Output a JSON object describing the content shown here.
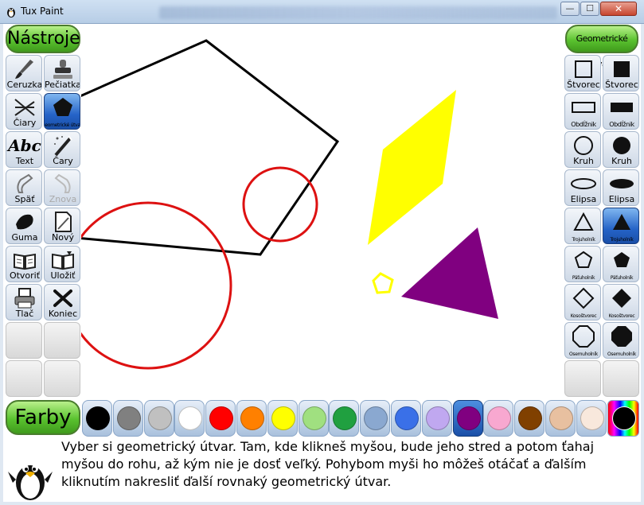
{
  "window": {
    "title": "Tux Paint",
    "controls": {
      "minimize": "—",
      "maximize": "☐",
      "close": "✕"
    }
  },
  "tools_header": "Nástroje",
  "tools": [
    {
      "label": "Ceruzka",
      "icon": "brush-icon"
    },
    {
      "label": "Pečiatka",
      "icon": "stamp-icon"
    },
    {
      "label": "Čiary",
      "icon": "lines-icon"
    },
    {
      "label": "Geometrické útvary",
      "icon": "pentagon-icon",
      "selected": true
    },
    {
      "label": "Text",
      "icon": "text-icon"
    },
    {
      "label": "Čary",
      "icon": "magic-wand-icon"
    },
    {
      "label": "Späť",
      "icon": "undo-icon"
    },
    {
      "label": "Znova",
      "icon": "redo-icon",
      "disabled": true
    },
    {
      "label": "Guma",
      "icon": "eraser-icon"
    },
    {
      "label": "Nový",
      "icon": "new-page-icon"
    },
    {
      "label": "Otvoriť",
      "icon": "open-book-icon"
    },
    {
      "label": "Uložiť",
      "icon": "save-book-icon"
    },
    {
      "label": "Tlač",
      "icon": "printer-icon"
    },
    {
      "label": "Koniec",
      "icon": "quit-icon"
    }
  ],
  "text_icon_glyph": "Abc",
  "shapes_header": "Geometrické útvary",
  "shapes": [
    {
      "label": "Štvorec",
      "icon": "square-outline-icon"
    },
    {
      "label": "Štvorec",
      "icon": "square-filled-icon"
    },
    {
      "label": "Obdĺžnik",
      "icon": "rectangle-outline-icon"
    },
    {
      "label": "Obdĺžnik",
      "icon": "rectangle-filled-icon"
    },
    {
      "label": "Kruh",
      "icon": "circle-outline-icon"
    },
    {
      "label": "Kruh",
      "icon": "circle-filled-icon"
    },
    {
      "label": "Elipsa",
      "icon": "ellipse-outline-icon"
    },
    {
      "label": "Elipsa",
      "icon": "ellipse-filled-icon"
    },
    {
      "label": "Trojuholník",
      "icon": "triangle-outline-icon"
    },
    {
      "label": "Trojuholník",
      "icon": "triangle-filled-icon",
      "selected": true
    },
    {
      "label": "Päťuholník",
      "icon": "pentagon-outline-icon"
    },
    {
      "label": "Päťuholník",
      "icon": "pentagon-filled-icon"
    },
    {
      "label": "Kosoštvorec",
      "icon": "diamond-outline-icon"
    },
    {
      "label": "Kosoštvorec",
      "icon": "diamond-filled-icon"
    },
    {
      "label": "Osemuholník",
      "icon": "octagon-outline-icon"
    },
    {
      "label": "Osemuholník",
      "icon": "octagon-filled-icon"
    }
  ],
  "colors_header": "Farby",
  "colors": [
    "#000000",
    "#808080",
    "#c0c0c0",
    "#ffffff",
    "#ff0000",
    "#ff8000",
    "#ffff00",
    "#a0e080",
    "#20a040",
    "#8aa8d0",
    "#3a70e8",
    "#c0a8f0",
    "#800080",
    "#f8a8d0",
    "#804000",
    "#e8c0a0",
    "#f8e8dc"
  ],
  "selected_color": "#800080",
  "canvas_shapes": {
    "black_pentagon_color": "#000000",
    "red_circles_color": "#dd1111",
    "yellow_color": "#ffff00",
    "purple_color": "#800080"
  },
  "instructions": "Vyber si geometrický útvar. Tam, kde klikneš myšou, bude jeho stred a potom ťahaj myšou do rohu, až kým nie je dosť veľký. Pohybom myši ho môžeš otáčať a ďalším kliknutím nakresliť ďalší rovnaký geometrický útvar."
}
